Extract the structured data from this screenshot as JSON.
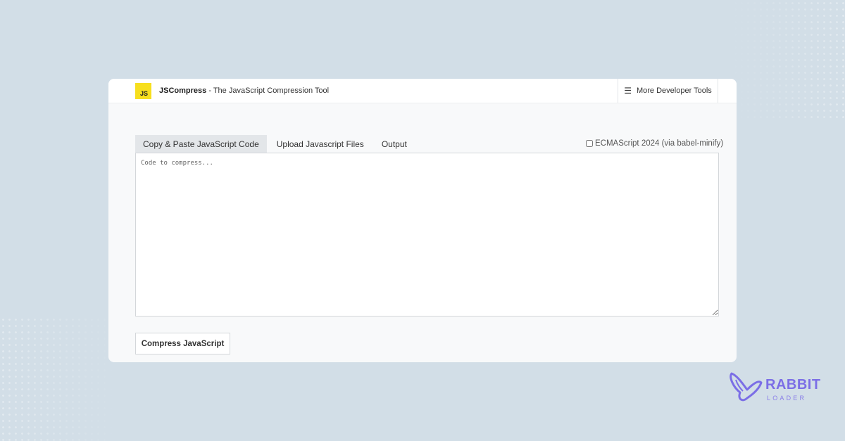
{
  "header": {
    "logo_text": "JS",
    "brand_name": "JSCompress",
    "brand_tagline": " - The JavaScript Compression Tool",
    "menu_icon": "hamburger-icon",
    "menu_label": "More Developer Tools"
  },
  "tabs": [
    {
      "label": "Copy & Paste JavaScript Code",
      "active": true
    },
    {
      "label": "Upload Javascript Files",
      "active": false
    },
    {
      "label": "Output",
      "active": false
    }
  ],
  "options": {
    "ecma_label": "ECMAScript 2024 (via babel-minify)",
    "ecma_checked": false
  },
  "editor": {
    "placeholder": "Code to compress...",
    "value": ""
  },
  "actions": {
    "compress_label": "Compress JavaScript"
  },
  "watermark": {
    "line1": "RABBIT",
    "line2": "LOADER",
    "icon": "rabbit-ears-icon",
    "color": "#7b6ee6"
  },
  "colors": {
    "background": "#d2dee7",
    "card": "#f8f9fa",
    "js_badge": "#f7df1e",
    "active_tab": "#e3e6e9"
  }
}
